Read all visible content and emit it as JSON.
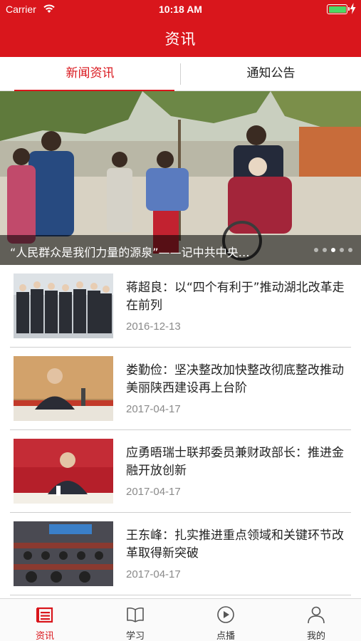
{
  "status_bar": {
    "carrier": "Carrier",
    "time": "10:18 AM"
  },
  "nav": {
    "title": "资讯"
  },
  "tabs": [
    {
      "label": "新闻资讯",
      "active": true
    },
    {
      "label": "通知公告",
      "active": false
    }
  ],
  "banner": {
    "caption": "“人民群众是我们力量的源泉”——记中共中央…",
    "page_count": 5,
    "active_page": 1
  },
  "news": [
    {
      "title": "蒋超良：以“四个有利于”推动湖北改革走在前列",
      "date": "2016-12-13"
    },
    {
      "title": "娄勤俭：坚决整改加快整改彻底整改推动美丽陕西建设再上台阶",
      "date": "2017-04-17"
    },
    {
      "title": "应勇晤瑞士联邦委员兼财政部长：推进金融开放创新",
      "date": "2017-04-17"
    },
    {
      "title": "王东峰：扎实推进重点领域和关键环节改革取得新突破",
      "date": "2017-04-17"
    }
  ],
  "tabbar": [
    {
      "label": "资讯",
      "icon": "news-icon",
      "active": true
    },
    {
      "label": "学习",
      "icon": "book-icon",
      "active": false
    },
    {
      "label": "点播",
      "icon": "play-icon",
      "active": false
    },
    {
      "label": "我的",
      "icon": "person-icon",
      "active": false
    }
  ],
  "colors": {
    "primary": "#d9161c",
    "text": "#222222",
    "date": "#8a8a8a"
  }
}
